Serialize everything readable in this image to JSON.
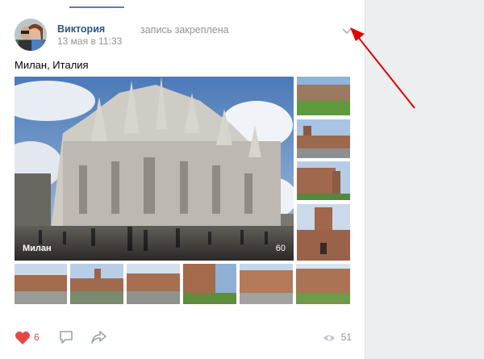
{
  "post": {
    "author": "Виктория",
    "pinned_label": "запись закреплена",
    "date": "13 мая в 11:33",
    "text": "Милан, Италия"
  },
  "album": {
    "main_caption": "Милан",
    "count": "60"
  },
  "actions": {
    "likes": "6",
    "views": "51"
  },
  "icons": [
    "chevron-down-icon",
    "heart-icon",
    "comment-icon",
    "share-icon",
    "eye-icon"
  ],
  "colors": {
    "link": "#2a5885",
    "like": "#e64646",
    "annotation_arrow": "#e00000"
  }
}
